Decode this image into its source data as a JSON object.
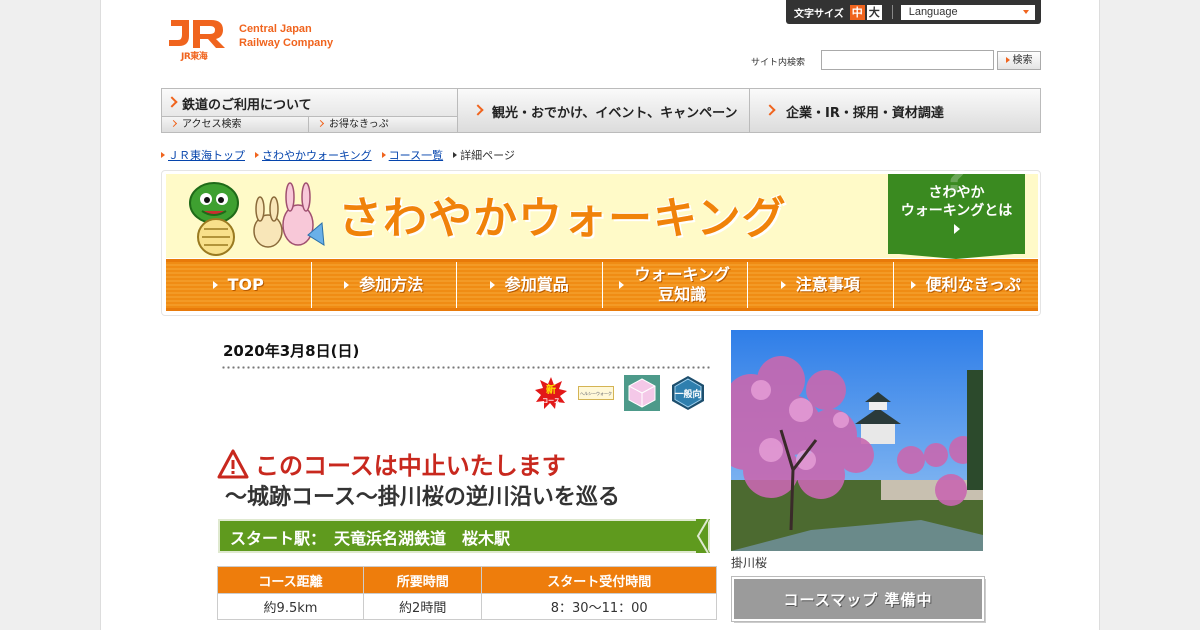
{
  "logo": {
    "jr_sub": "JR東海",
    "line1": "Central Japan",
    "line2": "Railway Company"
  },
  "util": {
    "font_size_label": "文字サイズ",
    "font_mid": "中",
    "font_large": "大",
    "language": "Language"
  },
  "search": {
    "label": "サイト内検索",
    "value": "",
    "button": "検索"
  },
  "gnav": {
    "rail": "鉄道のご利用について",
    "access": "アクセス検索",
    "tickets": "お得なきっぷ",
    "sightseeing": "観光・おでかけ、イベント、キャンペーン",
    "corporate": "企業・IR・採用・資材調達"
  },
  "breadcrumb": [
    "ＪＲ東海トップ",
    "さわやかウォーキング",
    "コース一覧",
    "詳細ページ"
  ],
  "walking": {
    "title": "さわやかウォーキング",
    "about_line1": "さわやか",
    "about_line2": "ウォーキングとは",
    "nav": [
      "TOP",
      "参加方法",
      "参加賞品",
      "ウォーキング\n豆知識",
      "注意事項",
      "便利なきっぷ"
    ]
  },
  "event": {
    "date": "2020年3月8日(日)",
    "badges": {
      "new_top": "新",
      "new_bottom": "コース",
      "healthy": "ヘルシーウォーク",
      "general": "一般向"
    },
    "cancel_notice": "このコースは中止いたします",
    "course_title": "～城跡コース～掛川桜の逆川沿いを巡る",
    "start_station": "スタート駅：　天竜浜名湖鉄道　桜木駅",
    "table": {
      "headers": [
        "コース距離",
        "所要時間",
        "スタート受付時間"
      ],
      "values": [
        "約9.5km",
        "約2時間",
        "8：30～11：00"
      ]
    },
    "photo_caption": "掛川桜",
    "map_button": "コースマップ 準備中"
  },
  "colors": {
    "brand": "#f0641e",
    "walking_orange": "#ee7d0c",
    "start_green": "#5f9a1e",
    "alert_red": "#c8281e"
  }
}
